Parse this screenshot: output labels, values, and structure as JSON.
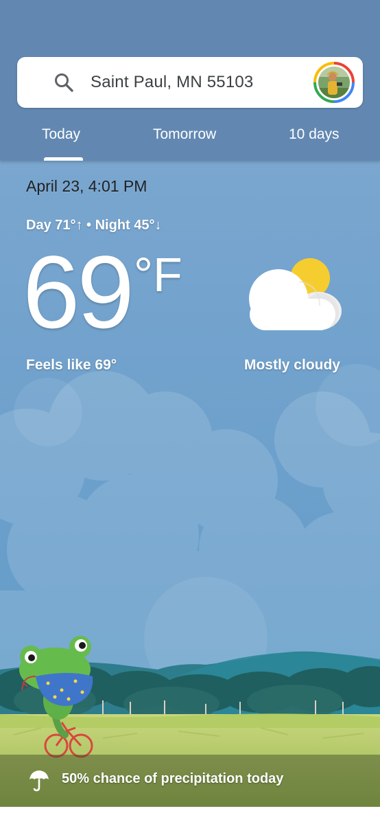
{
  "search": {
    "location": "Saint Paul, MN 55103",
    "icon": "search-icon"
  },
  "avatar": {
    "icon": "user-avatar-icon",
    "ring_colors": [
      "#4285f4",
      "#ea4335",
      "#fbbc05",
      "#34a853"
    ]
  },
  "tabs": [
    {
      "label": "Today",
      "selected": true
    },
    {
      "label": "Tomorrow",
      "selected": false
    },
    {
      "label": "10 days",
      "selected": false
    }
  ],
  "current": {
    "datetime": "April 23, 4:01 PM",
    "day_night": "Day 71°↑ • Night 45°↓",
    "temperature": "69",
    "unit": "°F",
    "feels_like": "Feels like 69°",
    "condition": "Mostly cloudy",
    "condition_icon": "mostly-cloudy-icon"
  },
  "precipitation": {
    "text": "50% chance of precipitation today",
    "icon": "umbrella-icon"
  },
  "colors": {
    "topbar": "#6288b2",
    "sky_top": "#7aa3cc",
    "sky_bottom": "#5e95c2",
    "mountain": "#2f7c8a",
    "grass": "#9fbf5a",
    "sun": "#f6cd2f"
  }
}
